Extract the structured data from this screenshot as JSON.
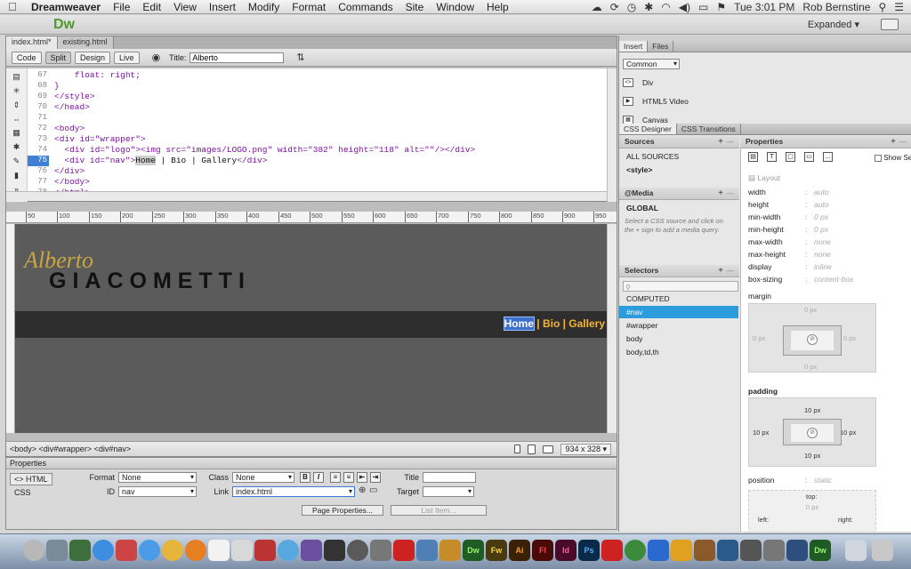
{
  "menubar": {
    "app": "Dreamweaver",
    "items": [
      "File",
      "Edit",
      "View",
      "Insert",
      "Modify",
      "Format",
      "Commands",
      "Site",
      "Window",
      "Help"
    ],
    "clock": "Tue 3:01 PM",
    "user": "Rob Bernstine"
  },
  "appbar": {
    "logo": "Dw",
    "workspace": "Expanded ▾"
  },
  "doc": {
    "tabs": [
      "index.html*",
      "existing.html"
    ],
    "views": [
      "Code",
      "Split",
      "Design",
      "Live"
    ],
    "title_label": "Title:",
    "title_value": "Alberto",
    "line_numbers": [
      "67",
      "68",
      "69",
      "70",
      "71",
      "72",
      "73",
      "74",
      "75",
      "76",
      "77",
      "78"
    ],
    "current_line": "75",
    "code": {
      "l67": "    float: right;",
      "l68": "}",
      "l69": "</style>",
      "l70": "</head>",
      "l71": "",
      "l72": "<body>",
      "l73": "<div id=\"wrapper\">",
      "l74": "  <div id=\"logo\"><img src=\"images/LOGO.png\" width=\"382\" height=\"118\" alt=\"\"/></div>",
      "l75a": "  <div id=\"nav\">",
      "l75b": "Home",
      "l75c": " | Bio | Gallery",
      "l75d": "</div>",
      "l76": "</div>",
      "l77": "</body>",
      "l78": "</html>"
    },
    "ruler": [
      "50",
      "100",
      "150",
      "200",
      "250",
      "300",
      "350",
      "400",
      "450",
      "500",
      "550",
      "600",
      "650",
      "700",
      "750",
      "800",
      "850",
      "900",
      "950"
    ],
    "design": {
      "logo_script": "Alberto",
      "logo_name": "GIACOMETTI",
      "nav_home": "Home",
      "nav_rest": " | Bio | Gallery"
    },
    "status": {
      "tags": "<body> <div#wrapper> <div#nav>",
      "size": "934 x 328 ▾"
    }
  },
  "properties": {
    "header": "Properties",
    "mode_html": "<> HTML",
    "mode_css": "CSS",
    "format_label": "Format",
    "format_value": "None",
    "class_label": "Class",
    "class_value": "None",
    "id_label": "ID",
    "id_value": "nav",
    "link_label": "Link",
    "link_value": "index.html",
    "title_label": "Title",
    "target_label": "Target",
    "page_properties": "Page Properties...",
    "list_item": "List Item..."
  },
  "insert_panel": {
    "tabs": [
      "Insert",
      "Files"
    ],
    "category": "Common",
    "items": [
      "Div",
      "HTML5 Video",
      "Canvas"
    ]
  },
  "css_designer": {
    "tabs": [
      "CSS Designer",
      "CSS Transitions"
    ],
    "sources_label": "Sources",
    "sources": [
      "ALL SOURCES",
      "<style>"
    ],
    "media_label": "@Media",
    "media_global": "GLOBAL",
    "media_hint": "Select a CSS source and click on the + sign to add a media query.",
    "selectors_label": "Selectors",
    "selectors": [
      "COMPUTED",
      "#nav",
      "#wrapper",
      "body",
      "body,td,th"
    ],
    "selected_selector": "#nav",
    "properties_label": "Properties",
    "show_set": "Show Se",
    "layout_label": "Layout",
    "layout_props": [
      {
        "k": "width",
        "v": "auto"
      },
      {
        "k": "height",
        "v": "auto"
      },
      {
        "k": "min-width",
        "v": "0 px"
      },
      {
        "k": "min-height",
        "v": "0 px"
      },
      {
        "k": "max-width",
        "v": "none"
      },
      {
        "k": "max-height",
        "v": "none"
      },
      {
        "k": "display",
        "v": "inline"
      },
      {
        "k": "box-sizing",
        "v": "content-box"
      }
    ],
    "margin_label": "margin",
    "margin": {
      "top": "0 px",
      "right": "0 px",
      "bottom": "0 px",
      "left": "0 px"
    },
    "padding_label": "padding",
    "padding": {
      "top": "10 px",
      "right": "10 px",
      "bottom": "10 px",
      "left": "10 px"
    },
    "position_label": "position",
    "position_value": "static",
    "pos_top": "top:",
    "pos_top_value": "0 px",
    "pos_left": "left:",
    "pos_right": "right:"
  },
  "dock": {
    "app_labels": [
      "Dw",
      "Fw",
      "Ai",
      "Fl",
      "Id",
      "Ps",
      "Dw"
    ]
  }
}
